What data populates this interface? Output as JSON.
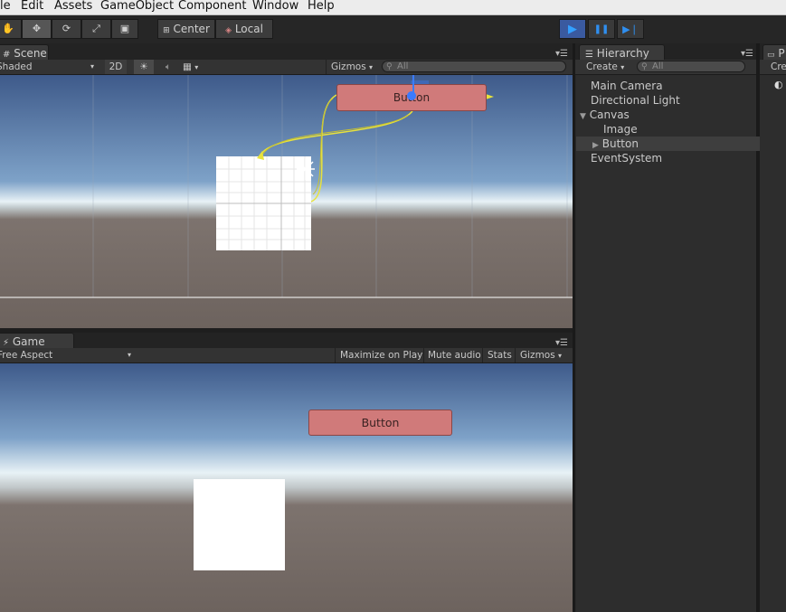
{
  "menu": [
    "le",
    "Edit",
    "Assets",
    "GameObject",
    "Component",
    "Window",
    "Help"
  ],
  "toolbar": {
    "tools": [
      "hand-tool",
      "move-tool",
      "rotate-tool",
      "scale-tool",
      "rect-tool"
    ],
    "pivot_label": "Center",
    "space_label": "Local",
    "play_glyph": "▶",
    "pause_glyph": "❚❚",
    "step_glyph": "▶❘"
  },
  "scene": {
    "tab_label": "Scene",
    "shading": "Shaded",
    "mode_2d": "2D",
    "gizmos_label": "Gizmos",
    "search_placeholder": "All",
    "button_text": "Button"
  },
  "game": {
    "tab_label": "Game",
    "aspect": "Free Aspect",
    "maximize_label": "Maximize on Play",
    "mute_label": "Mute audio",
    "stats_label": "Stats",
    "gizmos_label": "Gizmos",
    "button_text": "Button"
  },
  "hierarchy": {
    "tab_label": "Hierarchy",
    "create_label": "Create",
    "search_placeholder": "All",
    "items": [
      {
        "label": "Main Camera"
      },
      {
        "label": "Directional Light"
      },
      {
        "label": "Canvas"
      },
      {
        "label": "Image"
      },
      {
        "label": "Button"
      },
      {
        "label": "EventSystem"
      }
    ]
  },
  "project": {
    "tab_label": "P",
    "create_label": "Cre"
  },
  "colors": {
    "ui_button": "#d07a7a",
    "sky_top": "#3e5a8a",
    "horizon": "#e8f2f6",
    "ground": "#6d635e",
    "play_active": "#33a0ff",
    "gizmo_yellow": "#e8e23c"
  }
}
